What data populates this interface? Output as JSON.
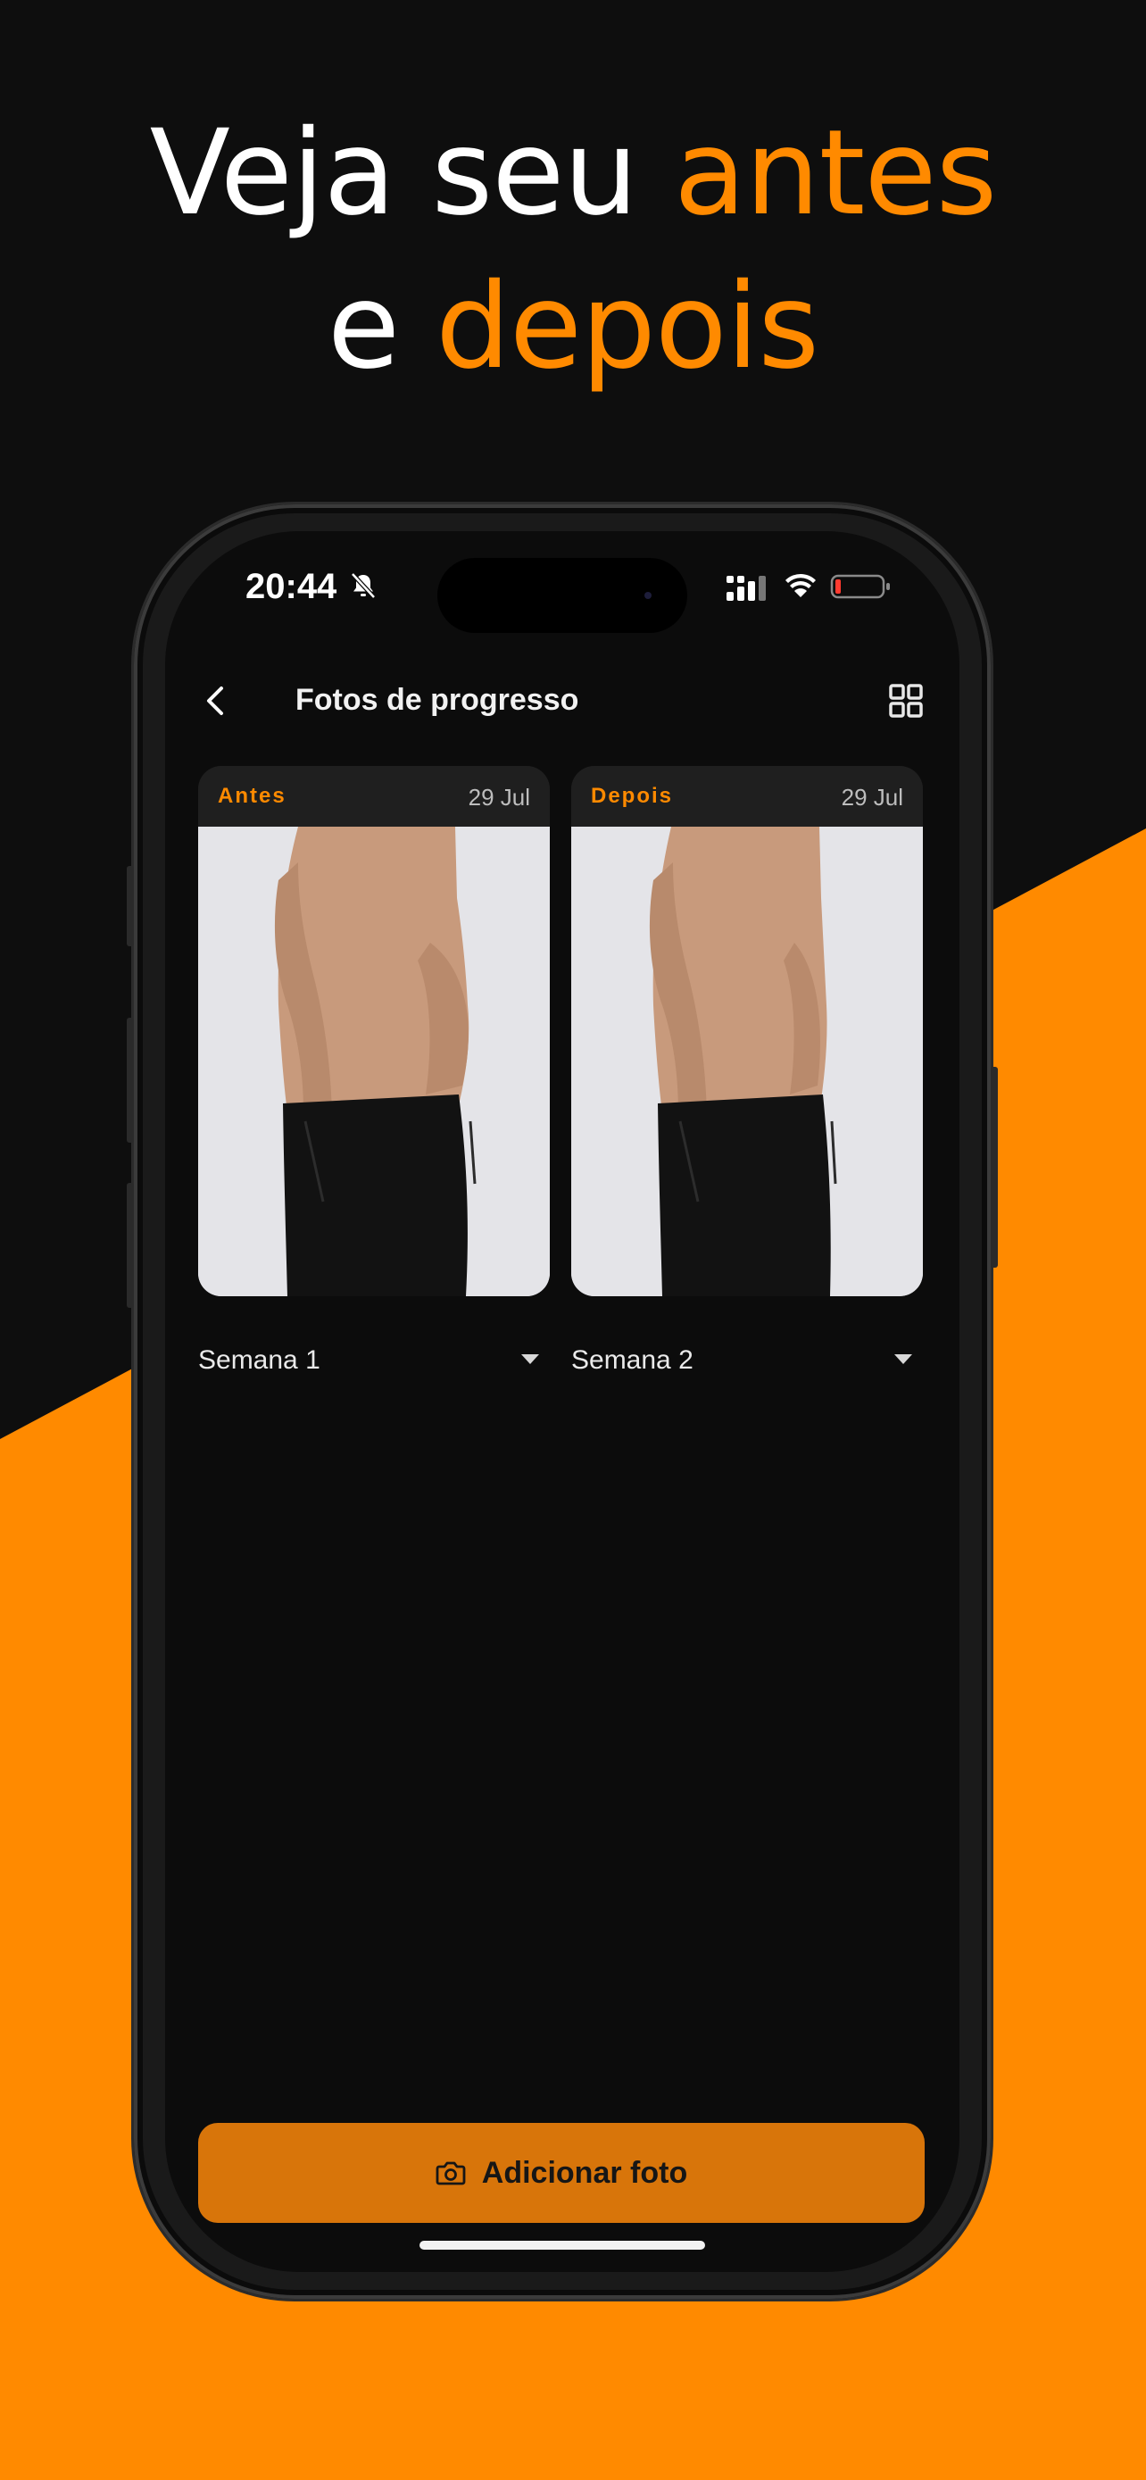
{
  "headline": {
    "line1_white": "Veja seu ",
    "line1_accent": "antes",
    "line2_white": "e ",
    "line2_accent": "depois"
  },
  "status_bar": {
    "time": "20:44",
    "icons": [
      "bell-slash-icon",
      "signal-icon",
      "wifi-icon",
      "battery-icon"
    ]
  },
  "nav": {
    "title": "Fotos de progresso",
    "back_icon": "chevron-left-icon",
    "grid_icon": "grid-icon"
  },
  "cards": [
    {
      "label": "Antes",
      "date": "29 Jul",
      "week": "Semana 1"
    },
    {
      "label": "Depois",
      "date": "29 Jul",
      "week": "Semana 2"
    }
  ],
  "action": {
    "label": "Adicionar foto",
    "icon": "camera-icon"
  },
  "colors": {
    "accent": "#ff8a00",
    "background": "#0e0e0e",
    "button": "#d8750a"
  }
}
